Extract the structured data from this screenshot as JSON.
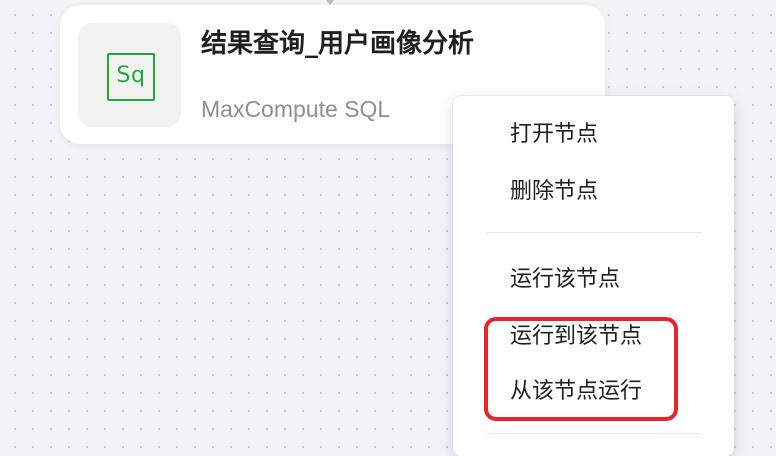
{
  "node": {
    "icon": "sql-icon",
    "icon_text": "Sq",
    "title": "结果查询_用户画像分析",
    "subtitle": "MaxCompute SQL"
  },
  "context_menu": {
    "items": [
      {
        "label": "打开节点"
      },
      {
        "label": "删除节点"
      },
      {
        "label": "运行该节点"
      },
      {
        "label": "运行到该节点"
      },
      {
        "label": "从该节点运行"
      }
    ]
  },
  "colors": {
    "accent_green": "#22a83a",
    "highlight_red": "#e8232b"
  }
}
